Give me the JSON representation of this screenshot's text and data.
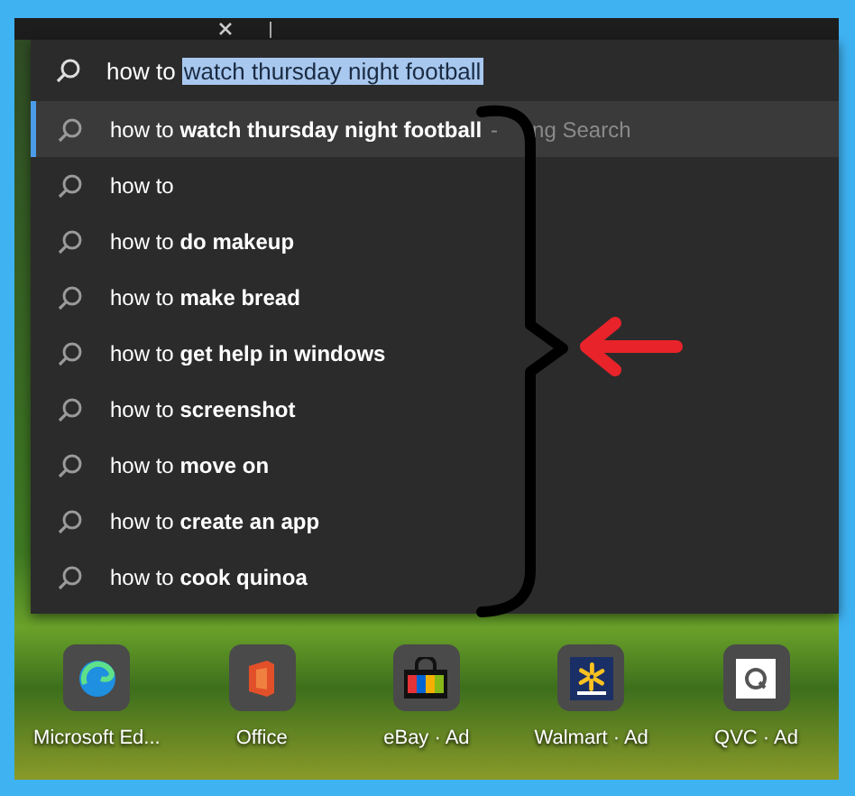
{
  "search": {
    "prefix": "how to",
    "selection": "watch thursday night football"
  },
  "suggestions": [
    {
      "text": "how to **watch thursday night football**",
      "selected": true,
      "dash": "-",
      "suffix": "ng Search"
    },
    {
      "text": "how to",
      "selected": false
    },
    {
      "text": "how to **do makeup**",
      "selected": false
    },
    {
      "text": "how to **make bread**",
      "selected": false
    },
    {
      "text": "how to **get help in windows**",
      "selected": false
    },
    {
      "text": "how to **screenshot**",
      "selected": false
    },
    {
      "text": "how to **move on**",
      "selected": false
    },
    {
      "text": "how to **create an app**",
      "selected": false
    },
    {
      "text": "how to **cook quinoa**",
      "selected": false
    }
  ],
  "apps": [
    {
      "label": "Microsoft Ed...",
      "kind": "edge"
    },
    {
      "label": "Office",
      "kind": "office"
    },
    {
      "label": "eBay · Ad",
      "kind": "ebay"
    },
    {
      "label": "Walmart · Ad",
      "kind": "walmart"
    },
    {
      "label": "QVC · Ad",
      "kind": "qvc"
    }
  ]
}
